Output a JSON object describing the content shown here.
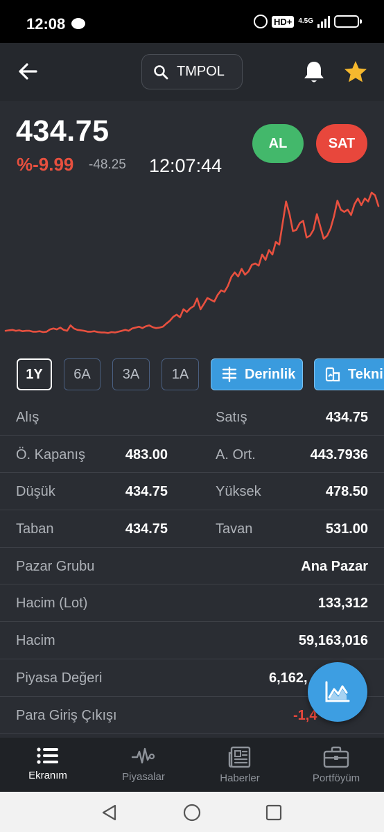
{
  "status_bar": {
    "time": "12:08",
    "hd": "HD+",
    "network": "4.5G"
  },
  "header": {
    "symbol": "TMPOL"
  },
  "quote": {
    "price": "434.75",
    "change_pct": "%-9.99",
    "change_abs": "-48.25",
    "time": "12:07:44",
    "buy_label": "AL",
    "sell_label": "SAT"
  },
  "chart_data": {
    "type": "line",
    "title": "",
    "xlabel": "",
    "ylabel": "",
    "line_color": "#e8503f",
    "x": [
      0,
      5,
      10,
      15,
      20,
      25,
      30,
      35,
      40,
      45,
      50,
      55,
      60,
      65,
      70,
      75,
      80,
      85,
      90,
      95,
      100,
      105,
      110,
      115,
      120,
      125,
      130,
      135,
      140,
      145,
      150,
      155,
      160,
      165,
      170,
      175,
      180,
      185,
      190,
      195,
      200,
      205,
      210,
      215,
      220,
      225,
      230,
      235,
      240,
      245,
      250,
      255,
      260,
      265,
      270,
      275,
      280,
      285,
      290,
      295,
      300,
      305,
      310,
      315,
      320,
      325,
      330,
      335,
      340,
      345,
      350,
      355,
      360,
      365,
      370,
      375,
      380,
      385,
      390,
      395,
      400,
      405,
      410,
      415,
      420,
      425,
      430,
      435,
      440,
      445,
      450,
      455,
      460,
      465,
      470,
      475,
      480,
      485,
      490,
      495,
      500,
      505,
      510,
      515,
      520,
      525,
      530,
      535,
      540,
      545
    ],
    "values": [
      300,
      301,
      302,
      300,
      301,
      299,
      300,
      300,
      298,
      298,
      299,
      297,
      298,
      303,
      305,
      303,
      307,
      302,
      300,
      312,
      305,
      302,
      301,
      300,
      298,
      298,
      299,
      297,
      296,
      296,
      295,
      297,
      296,
      298,
      300,
      302,
      300,
      305,
      307,
      309,
      306,
      310,
      312,
      308,
      306,
      307,
      309,
      316,
      322,
      331,
      336,
      330,
      348,
      342,
      350,
      355,
      372,
      348,
      360,
      373,
      369,
      365,
      380,
      390,
      387,
      400,
      420,
      430,
      421,
      438,
      425,
      432,
      447,
      450,
      445,
      470,
      458,
      480,
      470,
      498,
      492,
      540,
      588,
      560,
      522,
      525,
      540,
      545,
      508,
      512,
      525,
      560,
      532,
      505,
      512,
      528,
      555,
      590,
      570,
      565,
      570,
      558,
      582,
      595,
      580,
      595,
      588,
      608,
      602,
      578
    ],
    "ylim": [
      280,
      620
    ]
  },
  "ranges": [
    "1Y",
    "6A",
    "3A",
    "1A"
  ],
  "tools": {
    "depth": "Derinlik",
    "technical": "Teknik"
  },
  "stats": {
    "alis_label": "Alış",
    "alis_value": "",
    "satis_label": "Satış",
    "satis_value": "434.75",
    "kapanis_label": "Ö. Kapanış",
    "kapanis_value": "483.00",
    "ort_label": "A. Ort.",
    "ort_value": "443.7936",
    "dusuk_label": "Düşük",
    "dusuk_value": "434.75",
    "yuksek_label": "Yüksek",
    "yuksek_value": "478.50",
    "taban_label": "Taban",
    "taban_value": "434.75",
    "tavan_label": "Tavan",
    "tavan_value": "531.00",
    "pazar_label": "Pazar Grubu",
    "pazar_value": "Ana Pazar",
    "hacim_lot_label": "Hacim (Lot)",
    "hacim_lot_value": "133,312",
    "hacim_label": "Hacim",
    "hacim_value": "59,163,016",
    "piyasa_label": "Piyasa Değeri",
    "piyasa_value": "6,162,",
    "para_label": "Para Giriş Çıkışı",
    "para_value": "-1,4"
  },
  "nav": [
    {
      "label": "Ekranım"
    },
    {
      "label": "Piyasalar"
    },
    {
      "label": "Haberler"
    },
    {
      "label": "Portföyüm"
    }
  ],
  "colors": {
    "positive": "#43b86b",
    "negative": "#e8473c",
    "accent": "#3a9bde",
    "star": "#f5b82e"
  }
}
